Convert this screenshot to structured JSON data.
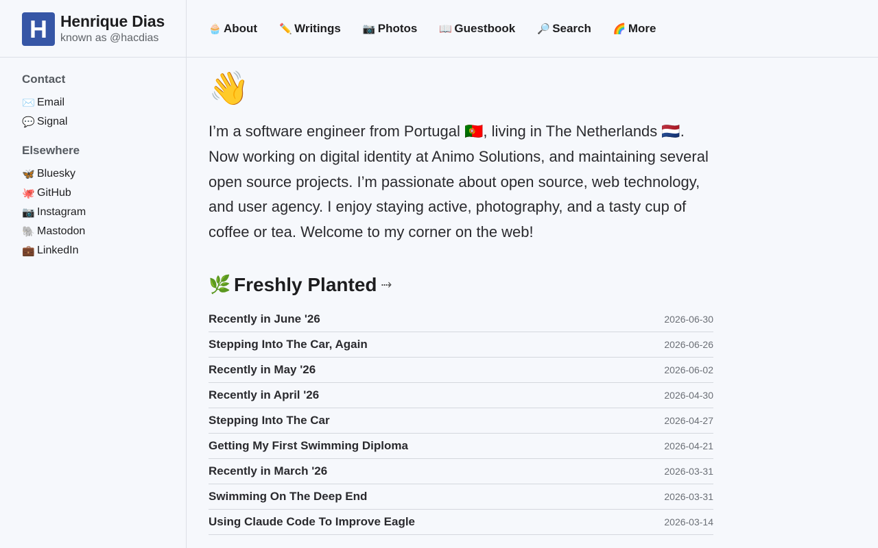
{
  "site": {
    "logo_letter": "H",
    "name": "Henrique Dias",
    "handle": "known as @hacdias"
  },
  "nav": [
    {
      "icon": "cupcake-icon",
      "emoji": "🧁",
      "label": "About"
    },
    {
      "icon": "pencil-icon",
      "emoji": "✏️",
      "label": "Writings"
    },
    {
      "icon": "camera-icon",
      "emoji": "📷",
      "label": "Photos"
    },
    {
      "icon": "book-icon",
      "emoji": "📖",
      "label": "Guestbook"
    },
    {
      "icon": "magnifier-icon",
      "emoji": "🔎",
      "label": "Search"
    },
    {
      "icon": "rainbow-icon",
      "emoji": "🌈",
      "label": "More"
    }
  ],
  "sidebar": {
    "contact": {
      "heading": "Contact",
      "items": [
        {
          "icon": "envelope-icon",
          "emoji": "✉️",
          "label": "Email"
        },
        {
          "icon": "speech-bubble-icon",
          "emoji": "💬",
          "label": "Signal"
        }
      ]
    },
    "elsewhere": {
      "heading": "Elsewhere",
      "items": [
        {
          "icon": "butterfly-icon",
          "emoji": "🦋",
          "label": "Bluesky"
        },
        {
          "icon": "octopus-icon",
          "emoji": "🐙",
          "label": "GitHub"
        },
        {
          "icon": "camera-icon",
          "emoji": "📷",
          "label": "Instagram"
        },
        {
          "icon": "elephant-icon",
          "emoji": "🐘",
          "label": "Mastodon"
        },
        {
          "icon": "briefcase-icon",
          "emoji": "💼",
          "label": "LinkedIn"
        }
      ]
    }
  },
  "main": {
    "wave_emoji": "👋",
    "intro": "I’m a software engineer from Portugal 🇵🇹, living in The Netherlands 🇳🇱. Now working on digital identity at Animo Solutions, and maintaining several open source projects. I’m passionate about open source, web technology, and user agency. I enjoy staying active, photography, and a tasty cup of coffee or tea. Welcome to my corner on the web!",
    "section": {
      "emoji": "🌿",
      "title": "Freshly Planted",
      "arrow": "⤑"
    },
    "posts": [
      {
        "title": "Recently in June '26",
        "date": "2026-06-30"
      },
      {
        "title": "Stepping Into The Car, Again",
        "date": "2026-06-26"
      },
      {
        "title": "Recently in May '26",
        "date": "2026-06-02"
      },
      {
        "title": "Recently in April '26",
        "date": "2026-04-30"
      },
      {
        "title": "Stepping Into The Car",
        "date": "2026-04-27"
      },
      {
        "title": "Getting My First Swimming Diploma",
        "date": "2026-04-21"
      },
      {
        "title": "Recently in March '26",
        "date": "2026-03-31"
      },
      {
        "title": "Swimming On The Deep End",
        "date": "2026-03-31"
      },
      {
        "title": "Using Claude Code To Improve Eagle",
        "date": "2026-03-14"
      }
    ]
  }
}
